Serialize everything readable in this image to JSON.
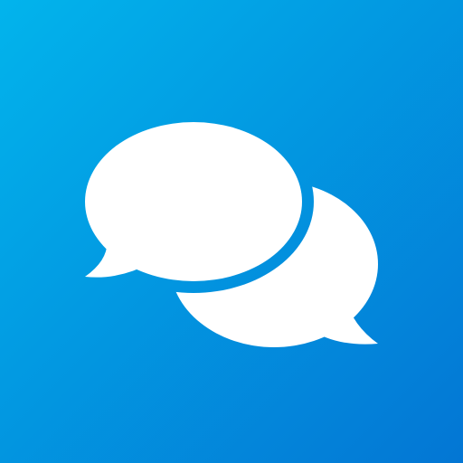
{
  "icon": {
    "name": "chat-bubbles-icon",
    "gradient_start": "#02b4ec",
    "gradient_end": "#0376d4",
    "glyph_color": "#ffffff"
  }
}
